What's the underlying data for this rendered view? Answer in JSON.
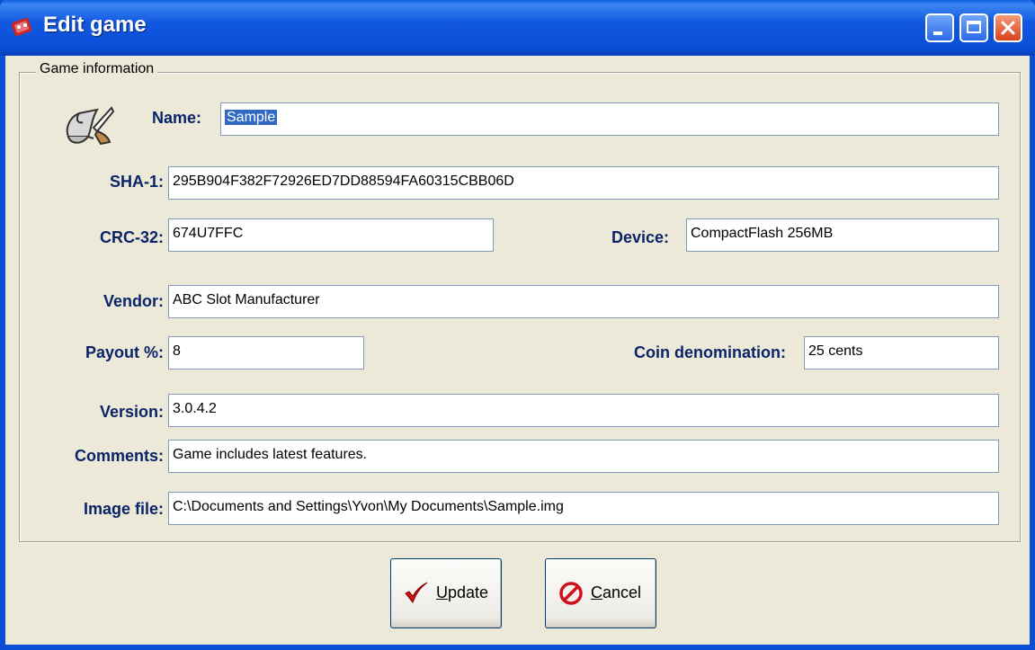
{
  "window": {
    "title": "Edit game",
    "icon": "game-app-icon",
    "controls": [
      "minimize",
      "maximize",
      "close"
    ]
  },
  "group": {
    "legend": "Game information",
    "icon": "scroll-quill-icon"
  },
  "fields": {
    "name": {
      "label": "Name:",
      "value": "Sample",
      "selected": true
    },
    "sha1": {
      "label": "SHA-1:",
      "value": "295B904F382F72926ED7DD88594FA60315CBB06D"
    },
    "crc32": {
      "label": "CRC-32:",
      "value": "674U7FFC"
    },
    "device": {
      "label": "Device:",
      "value": "CompactFlash 256MB"
    },
    "vendor": {
      "label": "Vendor:",
      "value": "ABC Slot Manufacturer"
    },
    "payout": {
      "label": "Payout %:",
      "value": "8"
    },
    "coin": {
      "label": "Coin denomination:",
      "value": "25 cents"
    },
    "version": {
      "label": "Version:",
      "value": "3.0.4.2"
    },
    "comments": {
      "label": "Comments:",
      "value": "Game includes latest features."
    },
    "image_file": {
      "label": "Image file:",
      "value": "C:\\Documents and Settings\\Yvon\\My Documents\\Sample.img"
    }
  },
  "buttons": {
    "update": {
      "mnemonic": "U",
      "rest": "pdate",
      "icon": "checkmark-icon"
    },
    "cancel": {
      "mnemonic": "C",
      "rest": "ancel",
      "icon": "no-entry-icon"
    }
  },
  "colors": {
    "titlebar": "#0a4fd6",
    "label": "#0a246a",
    "selection": "#316ac5",
    "dialog_bg": "#ece9d8"
  }
}
